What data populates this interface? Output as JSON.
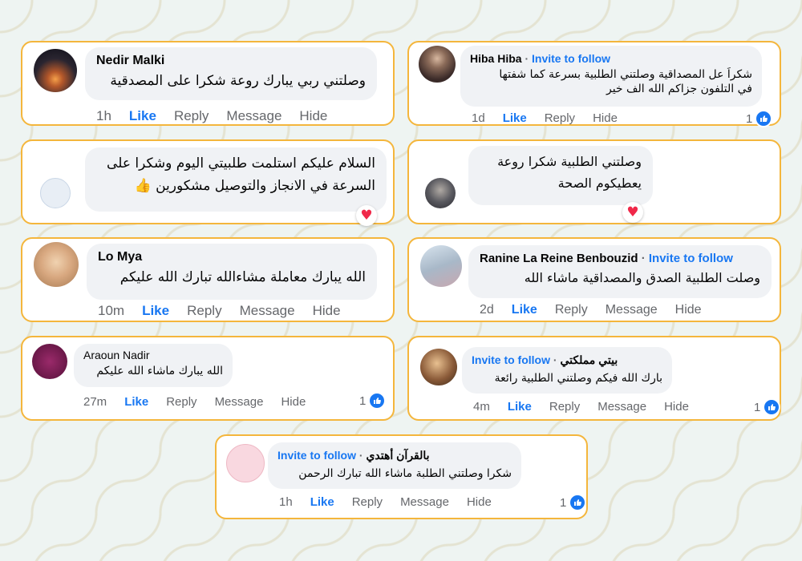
{
  "ui": {
    "invite": "Invite to follow",
    "like": "Like",
    "reply": "Reply",
    "message": "Message",
    "hide": "Hide",
    "sep": "·"
  },
  "comments": [
    {
      "name": "Nedir Malki",
      "text": "وصلتني ربي يبارك روعة شكرا على المصدقية",
      "time": "1h"
    },
    {
      "name": "Hiba Hiba",
      "text1": "شكراَ عل المصداقية وصلتني الطلبية بسرعة كما شفتها",
      "text2": "في التلفون جزاكم الله الف خير",
      "time": "1d",
      "count": "1"
    },
    {
      "text1": "السلام عليكم استلمت طلبيتي اليوم وشكرا على",
      "text2": "السرعة في الانجاز والتوصيل مشكورين 👍"
    },
    {
      "text1": "وصلتني الطلبية شكرا  روعة",
      "text2": "يعطيكوم الصحة"
    },
    {
      "name": "Lo Mya",
      "text": "الله يبارك  معاملة مشاءالله تبارك الله عليكم",
      "time": "10m"
    },
    {
      "name": "Ranine La Reine Benbouzid",
      "text": "وصلت الطلبية الصدق والمصداقية ماشاء الله",
      "time": "2d"
    },
    {
      "name": "Araoun Nadir",
      "text": "الله يبارك ماشاء الله عليكم",
      "time": "27m",
      "count": "1"
    },
    {
      "name": "بيتي  مملكتي",
      "text": "بارك الله فيكم وصلتني الطلبية رائعة",
      "time": "4m",
      "count": "1"
    },
    {
      "name": "بالقرآن  أهتدي",
      "text": "شكرا وصلتني الطلبة ماشاء الله تبارك الرحمن",
      "time": "1h",
      "count": "1"
    }
  ],
  "colors": {
    "card_border": "#f4b63c",
    "bubble": "#f0f2f5",
    "link": "#1877f2",
    "meta": "#65676b"
  }
}
